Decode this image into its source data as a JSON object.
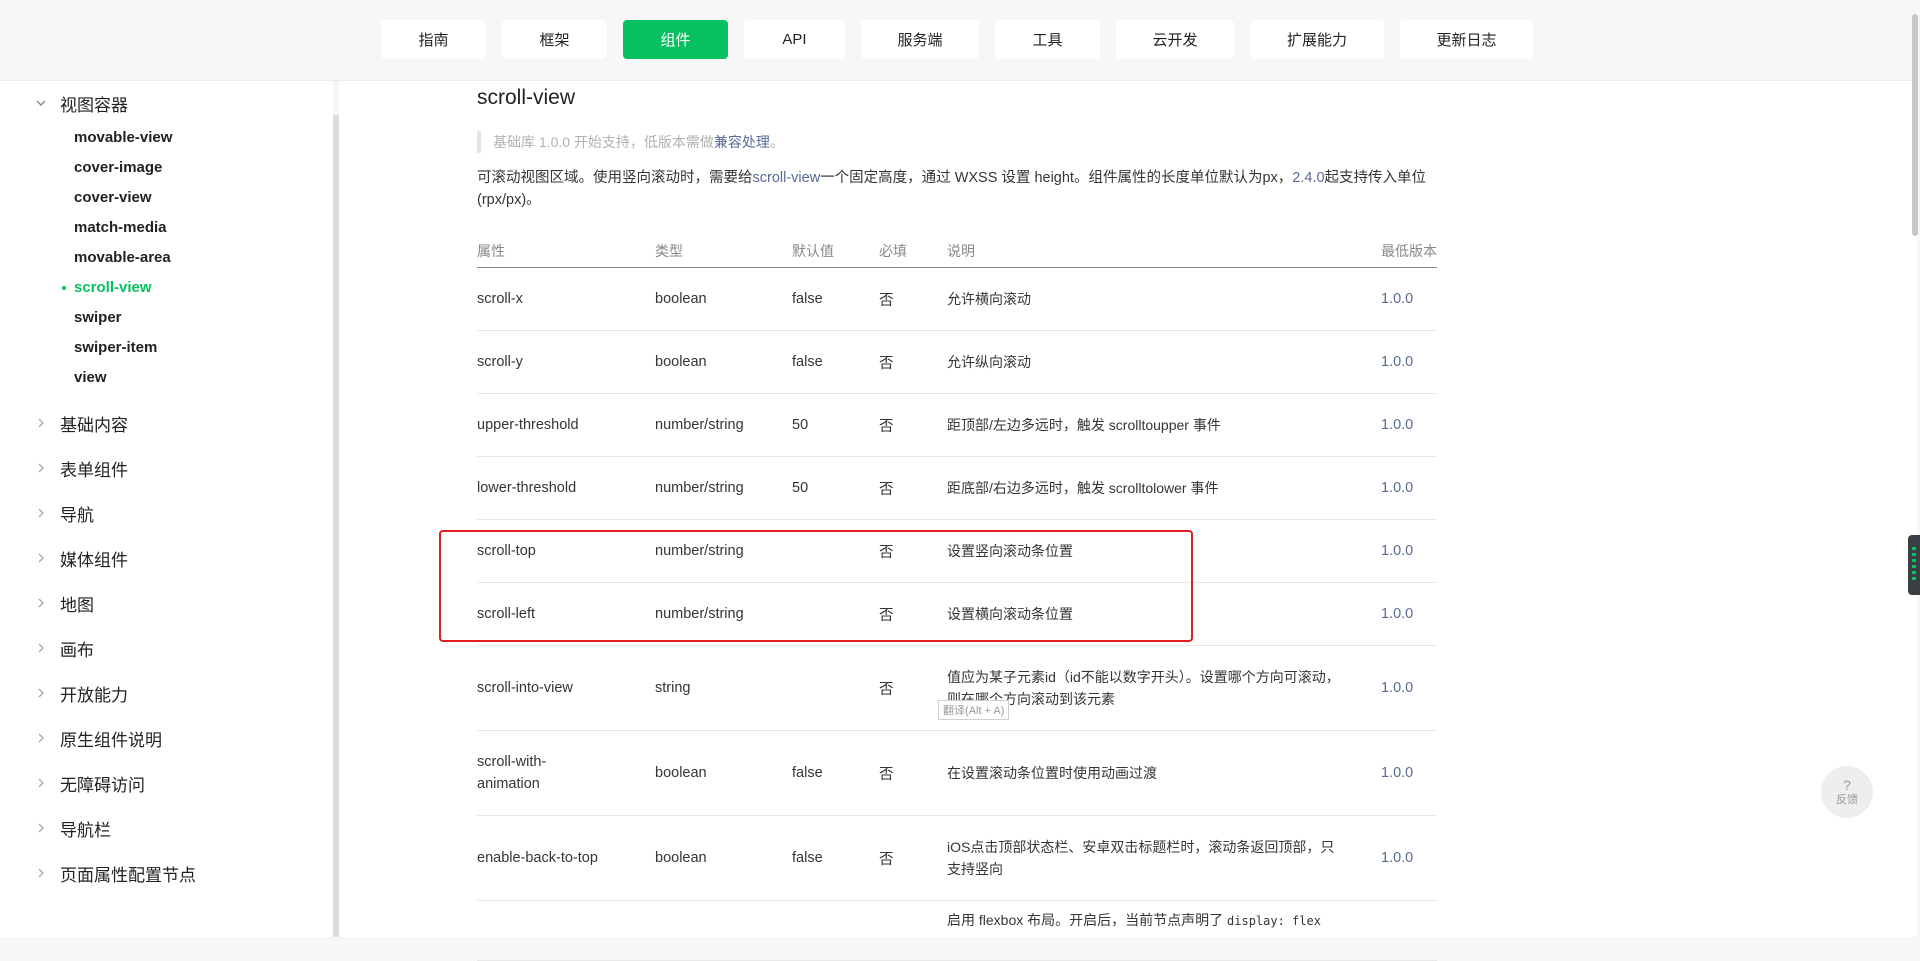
{
  "nav": {
    "tabs": [
      {
        "label": "指南",
        "active": false
      },
      {
        "label": "框架",
        "active": false
      },
      {
        "label": "组件",
        "active": true
      },
      {
        "label": "API",
        "active": false
      },
      {
        "label": "服务端",
        "active": false
      },
      {
        "label": "工具",
        "active": false
      },
      {
        "label": "云开发",
        "active": false
      },
      {
        "label": "扩展能力",
        "active": false
      },
      {
        "label": "更新日志",
        "active": false
      }
    ]
  },
  "sidebar": {
    "open_category": "视图容器",
    "sub_items": [
      "movable-view",
      "cover-image",
      "cover-view",
      "match-media",
      "movable-area",
      "scroll-view",
      "swiper",
      "swiper-item",
      "view"
    ],
    "active_sub_item": "scroll-view",
    "categories": [
      "基础内容",
      "表单组件",
      "导航",
      "媒体组件",
      "地图",
      "画布",
      "开放能力",
      "原生组件说明",
      "无障碍访问",
      "导航栏",
      "页面属性配置节点"
    ]
  },
  "page": {
    "title": "scroll-view",
    "note_prefix": "基础库 1.0.0 开始支持，低版本需做",
    "note_link": "兼容处理",
    "note_suffix": "。",
    "desc_part1": "可滚动视图区域。使用竖向滚动时，需要给",
    "desc_link1": "scroll-view",
    "desc_part2": "一个固定高度，通过 WXSS 设置 height。组件属性的长度单位默认为px，",
    "desc_link2": "2.4.0",
    "desc_part3": "起支持传入单位(rpx/px)。"
  },
  "table": {
    "headers": [
      "属性",
      "类型",
      "默认值",
      "必填",
      "说明",
      "最低版本"
    ],
    "rows": [
      {
        "name": "scroll-x",
        "type": "boolean",
        "default": "false",
        "required": "否",
        "desc": "允许横向滚动",
        "version": "1.0.0"
      },
      {
        "name": "scroll-y",
        "type": "boolean",
        "default": "false",
        "required": "否",
        "desc": "允许纵向滚动",
        "version": "1.0.0"
      },
      {
        "name": "upper-threshold",
        "type": "number/string",
        "default": "50",
        "required": "否",
        "desc": "距顶部/左边多远时，触发 scrolltoupper 事件",
        "version": "1.0.0"
      },
      {
        "name": "lower-threshold",
        "type": "number/string",
        "default": "50",
        "required": "否",
        "desc": "距底部/右边多远时，触发 scrolltolower 事件",
        "version": "1.0.0"
      },
      {
        "name": "scroll-top",
        "type": "number/string",
        "default": "",
        "required": "否",
        "desc": "设置竖向滚动条位置",
        "version": "1.0.0"
      },
      {
        "name": "scroll-left",
        "type": "number/string",
        "default": "",
        "required": "否",
        "desc": "设置横向滚动条位置",
        "version": "1.0.0"
      },
      {
        "name": "scroll-into-view",
        "type": "string",
        "default": "",
        "required": "否",
        "desc": "值应为某子元素id（id不能以数字开头）。设置哪个方向可滚动，则在哪个方向滚动到该元素",
        "version": "1.0.0"
      },
      {
        "name": "scroll-with-animation",
        "type": "boolean",
        "default": "false",
        "required": "否",
        "desc": "在设置滚动条位置时使用动画过渡",
        "version": "1.0.0"
      },
      {
        "name": "enable-back-to-top",
        "type": "boolean",
        "default": "false",
        "required": "否",
        "desc": "iOS点击顶部状态栏、安卓双击标题栏时，滚动条返回顶部，只支持竖向",
        "version": "1.0.0"
      }
    ],
    "last_row_desc_prefix": "启用 flexbox 布局。开启后，当前节点声明了",
    "last_row_desc_code": "display: flex"
  },
  "overlay": {
    "translate_tip": "翻译(Alt + A)"
  },
  "feedback": {
    "icon": "?",
    "label": "反馈"
  },
  "colors": {
    "accent": "#07c160",
    "link": "#576b95",
    "highlight_border": "#e02020"
  },
  "icons": {
    "chevron_down": "chevron-down-icon",
    "chevron_right": "chevron-right-icon",
    "feedback": "question-icon"
  }
}
